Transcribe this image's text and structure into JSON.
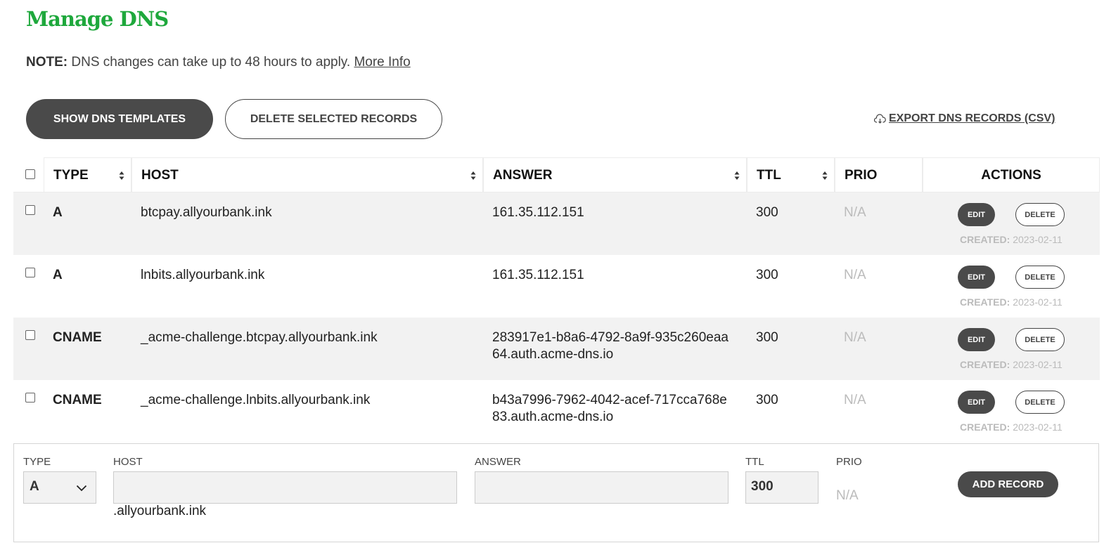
{
  "page": {
    "title": "Manage DNS",
    "note_label": "NOTE:",
    "note_text": " DNS changes can take up to 48 hours to apply. ",
    "note_link": "More Info"
  },
  "toolbar": {
    "show_templates": "SHOW DNS TEMPLATES",
    "delete_selected": "DELETE SELECTED RECORDS",
    "export": " EXPORT DNS RECORDS (CSV)"
  },
  "table": {
    "headers": {
      "type": "TYPE",
      "host": "HOST",
      "answer": "ANSWER",
      "ttl": "TTL",
      "prio": "PRIO",
      "actions": "ACTIONS"
    },
    "edit_label": "EDIT",
    "delete_label": "DELETE",
    "created_label": "CREATED:",
    "rows": [
      {
        "type": "A",
        "host": "btcpay.allyourbank.ink",
        "answer_line1": "161.35.112.151",
        "answer_line2": "",
        "ttl": "300",
        "prio": "N/A",
        "created": "2023-02-11"
      },
      {
        "type": "A",
        "host": "lnbits.allyourbank.ink",
        "answer_line1": "161.35.112.151",
        "answer_line2": "",
        "ttl": "300",
        "prio": "N/A",
        "created": "2023-02-11"
      },
      {
        "type": "CNAME",
        "host": "_acme-challenge.btcpay.allyourbank.ink",
        "answer_line1": "283917e1-b8a6-4792-8a9f-935c260eaa",
        "answer_line2": "64.auth.acme-dns.io",
        "ttl": "300",
        "prio": "N/A",
        "created": "2023-02-11"
      },
      {
        "type": "CNAME",
        "host": "_acme-challenge.lnbits.allyourbank.ink",
        "answer_line1": "b43a7996-7962-4042-acef-717cca768e",
        "answer_line2": "83.auth.acme-dns.io",
        "ttl": "300",
        "prio": "N/A",
        "created": "2023-02-11"
      }
    ]
  },
  "add_record": {
    "type_label": "TYPE",
    "type_value": "A",
    "host_label": "HOST",
    "host_value": "",
    "host_suffix": ".allyourbank.ink",
    "answer_label": "ANSWER",
    "answer_value": "",
    "ttl_label": "TTL",
    "ttl_value": "300",
    "prio_label": "PRIO",
    "prio_value": "N/A",
    "button": "ADD RECORD"
  },
  "icons": {
    "export": "cloud-download-icon",
    "sort": "sort-arrows-icon",
    "select": "chevron-down-icon"
  },
  "colors": {
    "brand": "#1ea83c",
    "button_dark": "#4a4a4a",
    "row_shade": "#f2f2f2",
    "muted": "#bbbbbb"
  }
}
